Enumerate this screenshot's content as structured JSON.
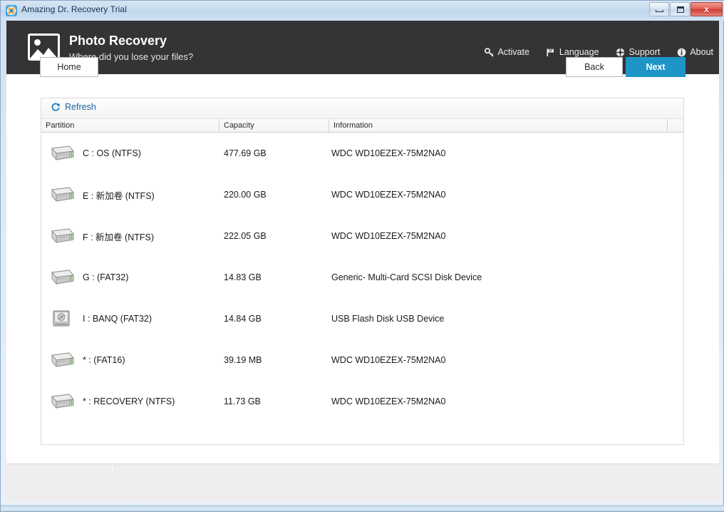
{
  "window": {
    "title": "Amazing Dr. Recovery Trial",
    "app_icon": "lifebuoy-icon",
    "minimize_label": "",
    "maximize_label": "",
    "close_label": "x"
  },
  "header": {
    "icon": "photo-icon",
    "title": "Photo Recovery",
    "subtitle": "Where did you lose your files?",
    "menu": [
      {
        "label": "Activate",
        "icon": "key-icon"
      },
      {
        "label": "Language",
        "icon": "flag-icon"
      },
      {
        "label": "Support",
        "icon": "lifebuoy-icon"
      },
      {
        "label": "About",
        "icon": "info-circle-icon"
      }
    ]
  },
  "toolbar": {
    "refresh_label": "Refresh",
    "refresh_icon": "refresh-icon",
    "link_color": "#1f63a8"
  },
  "table": {
    "columns": [
      "Partition",
      "Capacity",
      "Information",
      ""
    ],
    "rows": [
      {
        "icon": "hard-drive-icon",
        "partition": "C : OS  (NTFS)",
        "capacity": "477.69 GB",
        "information": "WDC  WD10EZEX-75M2NA0"
      },
      {
        "icon": "hard-drive-icon",
        "partition": "E : 新加卷  (NTFS)",
        "capacity": "220.00 GB",
        "information": "WDC  WD10EZEX-75M2NA0"
      },
      {
        "icon": "hard-drive-icon",
        "partition": "F : 新加卷  (NTFS)",
        "capacity": "222.05 GB",
        "information": "WDC  WD10EZEX-75M2NA0"
      },
      {
        "icon": "hard-drive-icon",
        "partition": "G :   (FAT32)",
        "capacity": "14.83 GB",
        "information": "Generic- Multi-Card  SCSI Disk Device"
      },
      {
        "icon": "usb-disk-icon",
        "partition": "I : BANQ  (FAT32)",
        "capacity": "14.84 GB",
        "information": "USB  Flash Disk  USB Device"
      },
      {
        "icon": "hard-drive-icon",
        "partition": "* :   (FAT16)",
        "capacity": "39.19 MB",
        "information": "WDC  WD10EZEX-75M2NA0"
      },
      {
        "icon": "hard-drive-icon",
        "partition": "* : RECOVERY  (NTFS)",
        "capacity": "11.73 GB",
        "information": "WDC  WD10EZEX-75M2NA0"
      }
    ]
  },
  "footer": {
    "home_label": "Home",
    "back_label": "Back",
    "next_label": "Next",
    "next_color": "#1d96c7"
  }
}
